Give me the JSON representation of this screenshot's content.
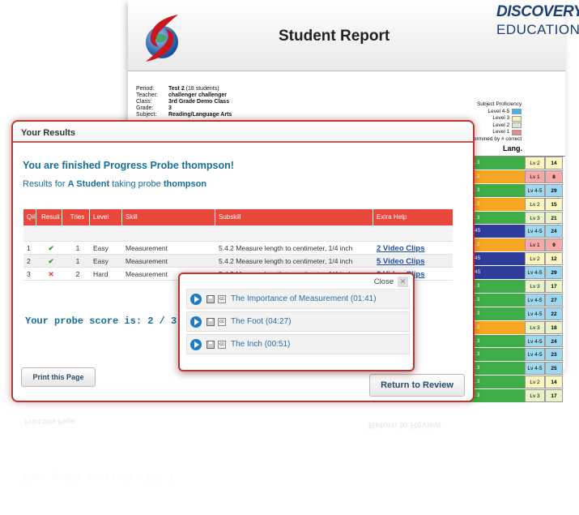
{
  "report": {
    "title": "Student Report",
    "brand_top": "DISCOVERY",
    "brand_bottom": "EDUCATION",
    "info": [
      {
        "label": "Period:",
        "value": "Test 2",
        "extra": "(18 students)"
      },
      {
        "label": "Teacher:",
        "value": "challenger challenger",
        "extra": ""
      },
      {
        "label": "Class:",
        "value": "3rd Grade Demo Class",
        "extra": ""
      },
      {
        "label": "Grade:",
        "value": "3",
        "extra": ""
      },
      {
        "label": "Subject:",
        "value": "Reading/Language Arts",
        "extra": ""
      }
    ],
    "proficiency_title": "Subject Proficiency",
    "proficiency_levels": [
      {
        "label": "Level 4-5",
        "color": "#3db6e8"
      },
      {
        "label": "Level 3",
        "color": "#f3f2b8"
      },
      {
        "label": "Level 2",
        "color": "#d4ecd0"
      },
      {
        "label": "Level 1",
        "color": "#f08a8a"
      }
    ],
    "proficiency_note": "determined by # correct",
    "lang_header": "Lang.",
    "lang_rows": [
      {
        "label": "L 3",
        "color": "#3fae49",
        "lv": "Lv 2",
        "lvcolor": "#fbf5c1",
        "num": "14"
      },
      {
        "label": "L 2",
        "color": "#f5a623",
        "lv": "Lv 1",
        "lvcolor": "#f7a8a8",
        "num": "8"
      },
      {
        "label": "L 3",
        "color": "#3fae49",
        "lv": "Lv 4-5",
        "lvcolor": "#9fd7ee",
        "num": "29"
      },
      {
        "label": "L 2",
        "color": "#f5a623",
        "lv": "Lv 2",
        "lvcolor": "#fbf5c1",
        "num": "15"
      },
      {
        "label": "L 3",
        "color": "#3fae49",
        "lv": "Lv 3",
        "lvcolor": "#e8f3c8",
        "num": "21"
      },
      {
        "label": "L45",
        "color": "#2e3d9c",
        "lv": "Lv 4-5",
        "lvcolor": "#9fd7ee",
        "num": "24"
      },
      {
        "label": "L 2",
        "color": "#f5a623",
        "lv": "Lv 1",
        "lvcolor": "#f7a8a8",
        "num": "9"
      },
      {
        "label": "L45",
        "color": "#2e3d9c",
        "lv": "Lv 2",
        "lvcolor": "#fbf5c1",
        "num": "12"
      },
      {
        "label": "L45",
        "color": "#2e3d9c",
        "lv": "Lv 4-5",
        "lvcolor": "#9fd7ee",
        "num": "29"
      },
      {
        "label": "L 3",
        "color": "#3fae49",
        "lv": "Lv 3",
        "lvcolor": "#e8f3c8",
        "num": "17"
      },
      {
        "label": "L 3",
        "color": "#3fae49",
        "lv": "Lv 4-5",
        "lvcolor": "#9fd7ee",
        "num": "27"
      },
      {
        "label": "L 3",
        "color": "#3fae49",
        "lv": "Lv 4-5",
        "lvcolor": "#9fd7ee",
        "num": "22"
      },
      {
        "label": "L 2",
        "color": "#f5a623",
        "lv": "Lv 3",
        "lvcolor": "#e8f3c8",
        "num": "18"
      },
      {
        "label": "L 3",
        "color": "#3fae49",
        "lv": "Lv 4-5",
        "lvcolor": "#9fd7ee",
        "num": "24"
      },
      {
        "label": "L 3",
        "color": "#3fae49",
        "lv": "Lv 4-5",
        "lvcolor": "#9fd7ee",
        "num": "23"
      },
      {
        "label": "L 3",
        "color": "#3fae49",
        "lv": "Lv 4-5",
        "lvcolor": "#9fd7ee",
        "num": "25"
      },
      {
        "label": "L 3",
        "color": "#3fae49",
        "lv": "Lv 2",
        "lvcolor": "#fbf5c1",
        "num": "14"
      },
      {
        "label": "L 3",
        "color": "#3fae49",
        "lv": "Lv 3",
        "lvcolor": "#e8f3c8",
        "num": "17"
      }
    ]
  },
  "results": {
    "title": "Your Results",
    "finished_text": "You are finished Progress Probe thompson!",
    "results_for_prefix": "Results for",
    "student": "A Student",
    "taking_probe": "taking probe",
    "probe": "thompson",
    "columns": [
      "Q#",
      "Result",
      "Tries",
      "Level",
      "Skill",
      "Subskill",
      "Extra Help"
    ],
    "rows": [
      {
        "q": "1",
        "result": "✔",
        "result_type": "ok",
        "tries": "1",
        "level": "Easy",
        "skill": "Measurement",
        "subskill": "5.4.2 Measure length to centimeter, 1/4 inch",
        "extra": "2 Video Clips"
      },
      {
        "q": "2",
        "result": "✔",
        "result_type": "ok",
        "tries": "1",
        "level": "Easy",
        "skill": "Measurement",
        "subskill": "5.4.2 Measure length to centimeter, 1/4 inch",
        "extra": "5 Video Clips"
      },
      {
        "q": "3",
        "result": "✕",
        "result_type": "bad",
        "tries": "2",
        "level": "Hard",
        "skill": "Measurement",
        "subskill": "5.4.2 Measure length to centimeter, 1/4 inch",
        "extra": "3 Video Clips"
      }
    ],
    "score_text": "Your probe score is: 2 / 3",
    "print_label": "Print this Page",
    "return_label": "Return to Review"
  },
  "videos": {
    "close_label": "Close",
    "close_icon": "✕",
    "items": [
      {
        "title": "The Importance of Measurement",
        "duration": "(01:41)"
      },
      {
        "title": "The Foot",
        "duration": "(04:27)"
      },
      {
        "title": "The Inch",
        "duration": "(00:51)"
      }
    ],
    "cc_label": "cc"
  }
}
